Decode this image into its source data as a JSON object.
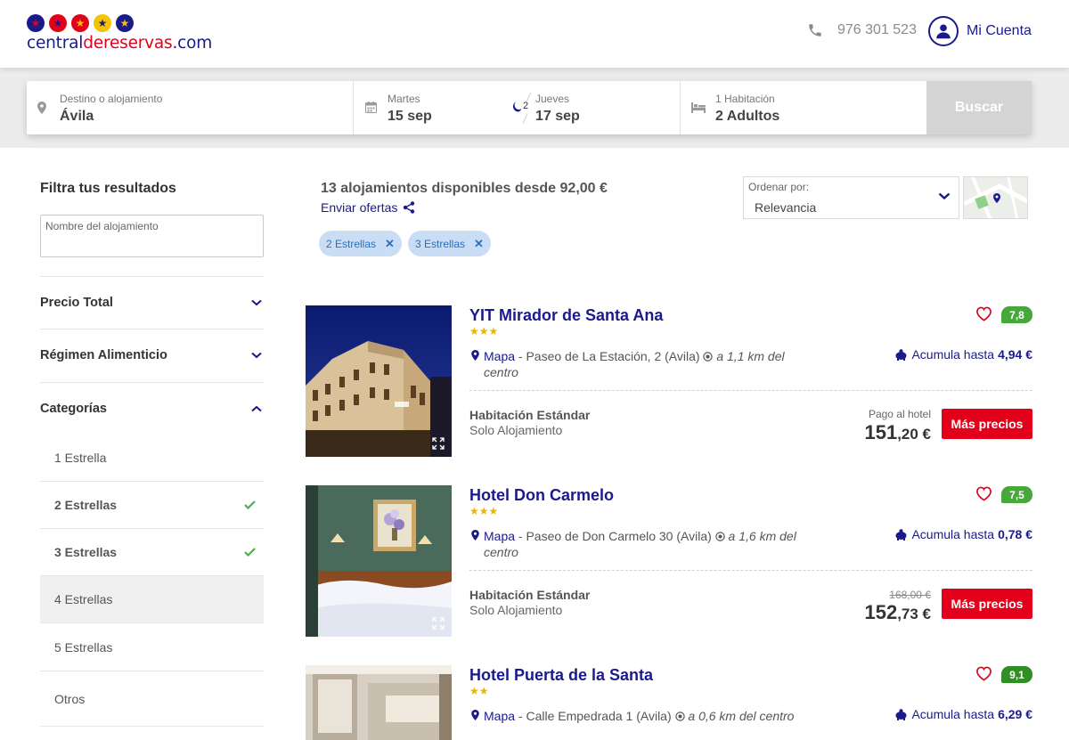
{
  "header": {
    "logo_part1": "central",
    "logo_part2": "dereservas",
    "logo_part3": ".com",
    "phone": "976 301 523",
    "account_label": "Mi Cuenta"
  },
  "search": {
    "destination_label": "Destino o alojamiento",
    "destination_value": "Ávila",
    "checkin_day": "Martes",
    "checkin_date": "15 sep",
    "nights": "2",
    "checkout_day": "Jueves",
    "checkout_date": "17 sep",
    "rooms_label": "1 Habitación",
    "guests_value": "2 Adultos",
    "button_label": "Buscar"
  },
  "sidebar": {
    "title": "Filtra tus resultados",
    "name_input_placeholder": "Nombre del alojamiento",
    "sections": [
      {
        "label": "Precio Total"
      },
      {
        "label": "Régimen Alimenticio"
      },
      {
        "label": "Categorías"
      }
    ],
    "categories": [
      {
        "label": "1 Estrella",
        "selected": false
      },
      {
        "label": "2 Estrellas",
        "selected": true
      },
      {
        "label": "3 Estrellas",
        "selected": true
      },
      {
        "label": "4 Estrellas",
        "selected": false
      },
      {
        "label": "5 Estrellas",
        "selected": false
      },
      {
        "label": "Otros",
        "selected": false
      }
    ]
  },
  "results": {
    "count_text": "13 alojamientos disponibles desde 92,00 €",
    "send_offers": "Enviar ofertas",
    "chips": [
      {
        "label": "2 Estrellas"
      },
      {
        "label": "3 Estrellas"
      }
    ],
    "sort_label": "Ordenar por:",
    "sort_value": "Relevancia"
  },
  "hotels": [
    {
      "name": "YIT Mirador de Santa Ana",
      "stars": "★★★",
      "map_link": "Mapa",
      "address": " - Paseo de La Estación, 2 (Avila) ",
      "distance": "a 1,1 km del centro",
      "score": "7,8",
      "accum_label": "Acumula hasta",
      "accum_value": "4,94 €",
      "room": "Habitación Estándar",
      "regime": "Solo Alojamiento",
      "pay_note": "Pago al hotel",
      "old_price": "",
      "price_int": "151",
      "price_dec": ",20 €",
      "button": "Más precios"
    },
    {
      "name": "Hotel Don Carmelo",
      "stars": "★★★",
      "map_link": "Mapa",
      "address": " - Paseo de Don Carmelo 30 (Avila) ",
      "distance": "a 1,6 km del centro",
      "score": "7,5",
      "accum_label": "Acumula hasta",
      "accum_value": "0,78 €",
      "room": "Habitación Estándar",
      "regime": "Solo Alojamiento",
      "pay_note": "",
      "old_price": "168,00 €",
      "price_int": "152",
      "price_dec": ",73 €",
      "button": "Más precios"
    },
    {
      "name": "Hotel Puerta de la Santa",
      "stars": "★★",
      "map_link": "Mapa",
      "address": " - Calle Empedrada 1 (Avila) ",
      "distance": "a 0,6 km del centro",
      "score": "9,1",
      "accum_label": "Acumula hasta",
      "accum_value": "6,29 €"
    }
  ],
  "colors": {
    "brand_blue": "#1a1a8c",
    "brand_red": "#e2001a",
    "score_green": "#47a83a",
    "score_green_dark": "#2f8f23",
    "check_green": "#4caf50",
    "star_gold": "#e8b600"
  }
}
